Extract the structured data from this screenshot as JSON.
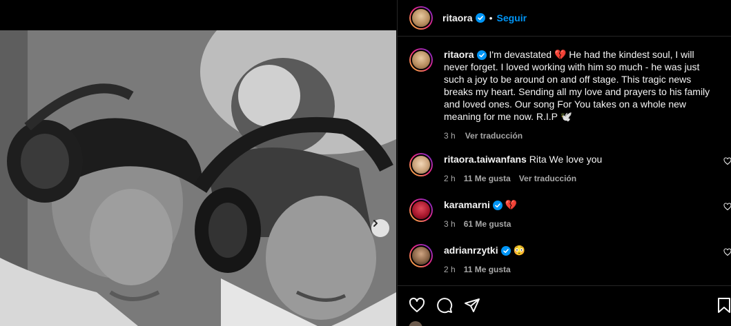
{
  "post": {
    "author": "ritaora",
    "follow_label": "Seguir",
    "separator": "•"
  },
  "caption": {
    "username": "ritaora",
    "text": "I'm devastated 💔 He had the kindest soul, I will never forget. I loved working with him so much - he was just such a joy to be around on and off stage. This tragic news breaks my heart. Sending all my love and prayers to his family and loved ones. Our song For You takes on a whole new meaning for me now. R.I.P 🕊️",
    "time": "3 h",
    "translate_label": "Ver traducción"
  },
  "comments": [
    {
      "username": "ritaora.taiwanfans",
      "text": "Rita We love you",
      "time": "2 h",
      "likes": "11 Me gusta",
      "translate_label": "Ver traducción",
      "verified": false
    },
    {
      "username": "karamarni",
      "text": "💔",
      "time": "3 h",
      "likes": "61 Me gusta",
      "verified": true
    },
    {
      "username": "adrianrzytki",
      "text": "😳",
      "time": "2 h",
      "likes": "11 Me gusta",
      "verified": true
    }
  ],
  "icons": {
    "verified": "verified-badge-icon",
    "like": "heart-icon",
    "comment": "comment-icon",
    "share": "share-icon",
    "save": "bookmark-icon",
    "next": "chevron-right-icon"
  },
  "colors": {
    "background": "#000000",
    "text": "#f5f5f5",
    "secondary_text": "#a8a8a8",
    "link": "#0095f6",
    "verified": "#0095f6",
    "divider": "#262626"
  }
}
